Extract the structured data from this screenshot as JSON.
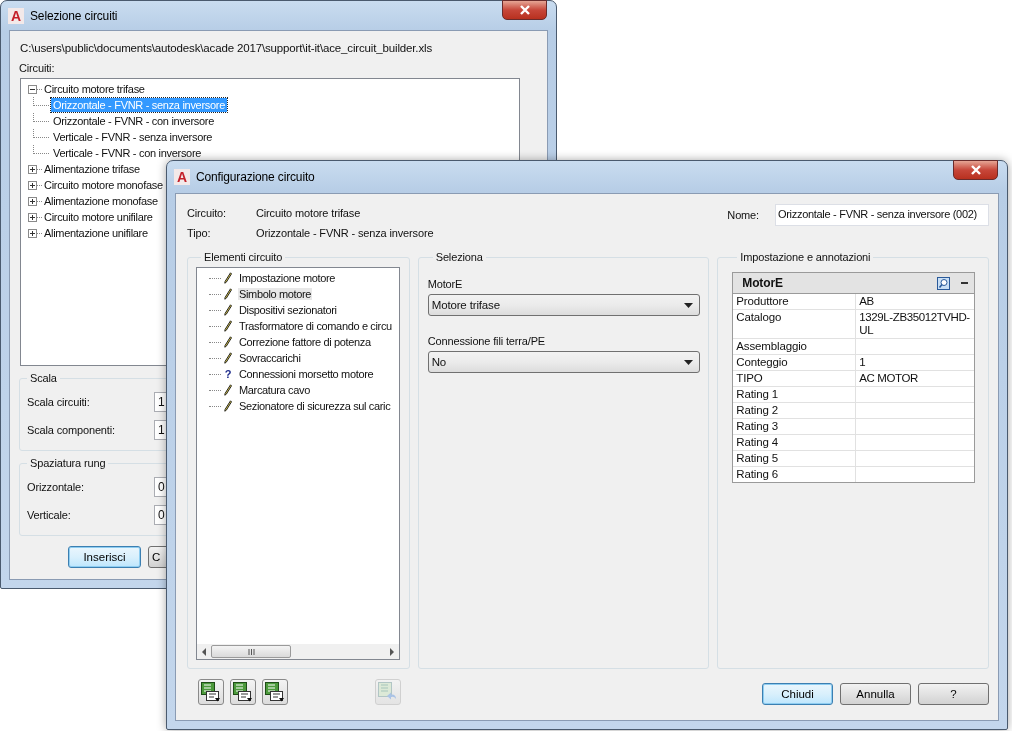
{
  "selection_window": {
    "logo": "A",
    "title": "Selezione circuiti",
    "path": "C:\\users\\public\\documents\\autodesk\\acade 2017\\support\\it-it\\ace_circuit_builder.xls",
    "tree_label": "Circuiti:",
    "tree": [
      {
        "label": "Circuito motore trifase",
        "expanded": true,
        "selected": false,
        "children": [
          {
            "label": "Orizzontale - FVNR - senza inversore",
            "selected": true
          },
          {
            "label": "Orizzontale - FVNR - con inversore",
            "selected": false
          },
          {
            "label": "Verticale - FVNR - senza inversore",
            "selected": false
          },
          {
            "label": "Verticale - FVNR - con inversore",
            "selected": false
          }
        ]
      },
      {
        "label": "Alimentazione trifase",
        "expanded": false,
        "selected": false
      },
      {
        "label": "Circuito motore monofase",
        "expanded": false,
        "selected": false
      },
      {
        "label": "Alimentazione monofase",
        "expanded": false,
        "selected": false
      },
      {
        "label": "Circuito motore unifilare",
        "expanded": false,
        "selected": false
      },
      {
        "label": "Alimentazione unifilare",
        "expanded": false,
        "selected": false
      }
    ],
    "groups": [
      {
        "title": "Scala",
        "fields": [
          {
            "label": "Scala circuiti:",
            "value": "1"
          },
          {
            "label": "Scala componenti:",
            "value": "1"
          }
        ]
      },
      {
        "title": "Spaziatura rung",
        "fields": [
          {
            "label": "Orizzontale:",
            "value": "0"
          },
          {
            "label": "Verticale:",
            "value": "0"
          }
        ]
      }
    ],
    "buttons": [
      {
        "label": "Inserisci",
        "focused": true
      },
      {
        "label": "C",
        "focused": false
      }
    ]
  },
  "config_window": {
    "logo": "A",
    "title": "Configurazione circuito",
    "info": [
      {
        "label": "Circuito:",
        "value": "Circuito motore trifase"
      },
      {
        "label": "Tipo:",
        "value": "Orizzontale - FVNR - senza inversore"
      }
    ],
    "name_field": {
      "label": "Nome:",
      "value": "Orizzontale - FVNR - senza inversore (002)"
    },
    "elements_group": {
      "title": "Elementi circuito",
      "items": [
        {
          "label": "Impostazione motore",
          "kind": "edit",
          "selected": false
        },
        {
          "label": "Simbolo motore",
          "kind": "edit",
          "selected": true
        },
        {
          "label": "Dispositivi sezionatori",
          "kind": "edit",
          "selected": false
        },
        {
          "label": "Trasformatore di comando e circu",
          "kind": "edit",
          "selected": false
        },
        {
          "label": "Correzione fattore di potenza",
          "kind": "edit",
          "selected": false
        },
        {
          "label": "Sovraccarichi",
          "kind": "edit",
          "selected": false
        },
        {
          "label": "Connessioni morsetto motore",
          "kind": "question",
          "icon": "?",
          "selected": false
        },
        {
          "label": "Marcatura cavo",
          "kind": "edit",
          "selected": false
        },
        {
          "label": "Sezionatore di sicurezza sul caric",
          "kind": "edit",
          "selected": false
        }
      ]
    },
    "select_group": {
      "title": "Seleziona",
      "fields": [
        {
          "label": "MotorE",
          "value": "Motore trifase"
        },
        {
          "label": "Connessione fili terra/PE",
          "value": "No"
        }
      ]
    },
    "annotations_group": {
      "title": "Impostazione e annotazioni",
      "grid": {
        "title": "MotorE",
        "expanded": true,
        "rows": [
          {
            "label": "Produttore",
            "value": "AB"
          },
          {
            "label": "Catalogo",
            "value": "1329L-ZB35012TVHD-UL"
          },
          {
            "label": "Assemblaggio"
          },
          {
            "label": "Conteggio",
            "value": "1"
          },
          {
            "label": "TIPO",
            "value": "AC MOTOR"
          },
          {
            "label": "Rating 1"
          },
          {
            "label": "Rating 2"
          },
          {
            "label": "Rating 3"
          },
          {
            "label": "Rating 4"
          },
          {
            "label": "Rating 5"
          },
          {
            "label": "Rating 6"
          }
        ]
      }
    },
    "toolbar": [
      {
        "kind": "insert",
        "disabled": false
      },
      {
        "kind": "insert",
        "disabled": false
      },
      {
        "kind": "insert",
        "disabled": false
      },
      {
        "kind": "undo",
        "disabled": true
      }
    ],
    "buttons": [
      {
        "label": "Chiudi",
        "focused": true
      },
      {
        "label": "Annulla",
        "focused": false
      },
      {
        "label": "?",
        "focused": false
      }
    ]
  }
}
